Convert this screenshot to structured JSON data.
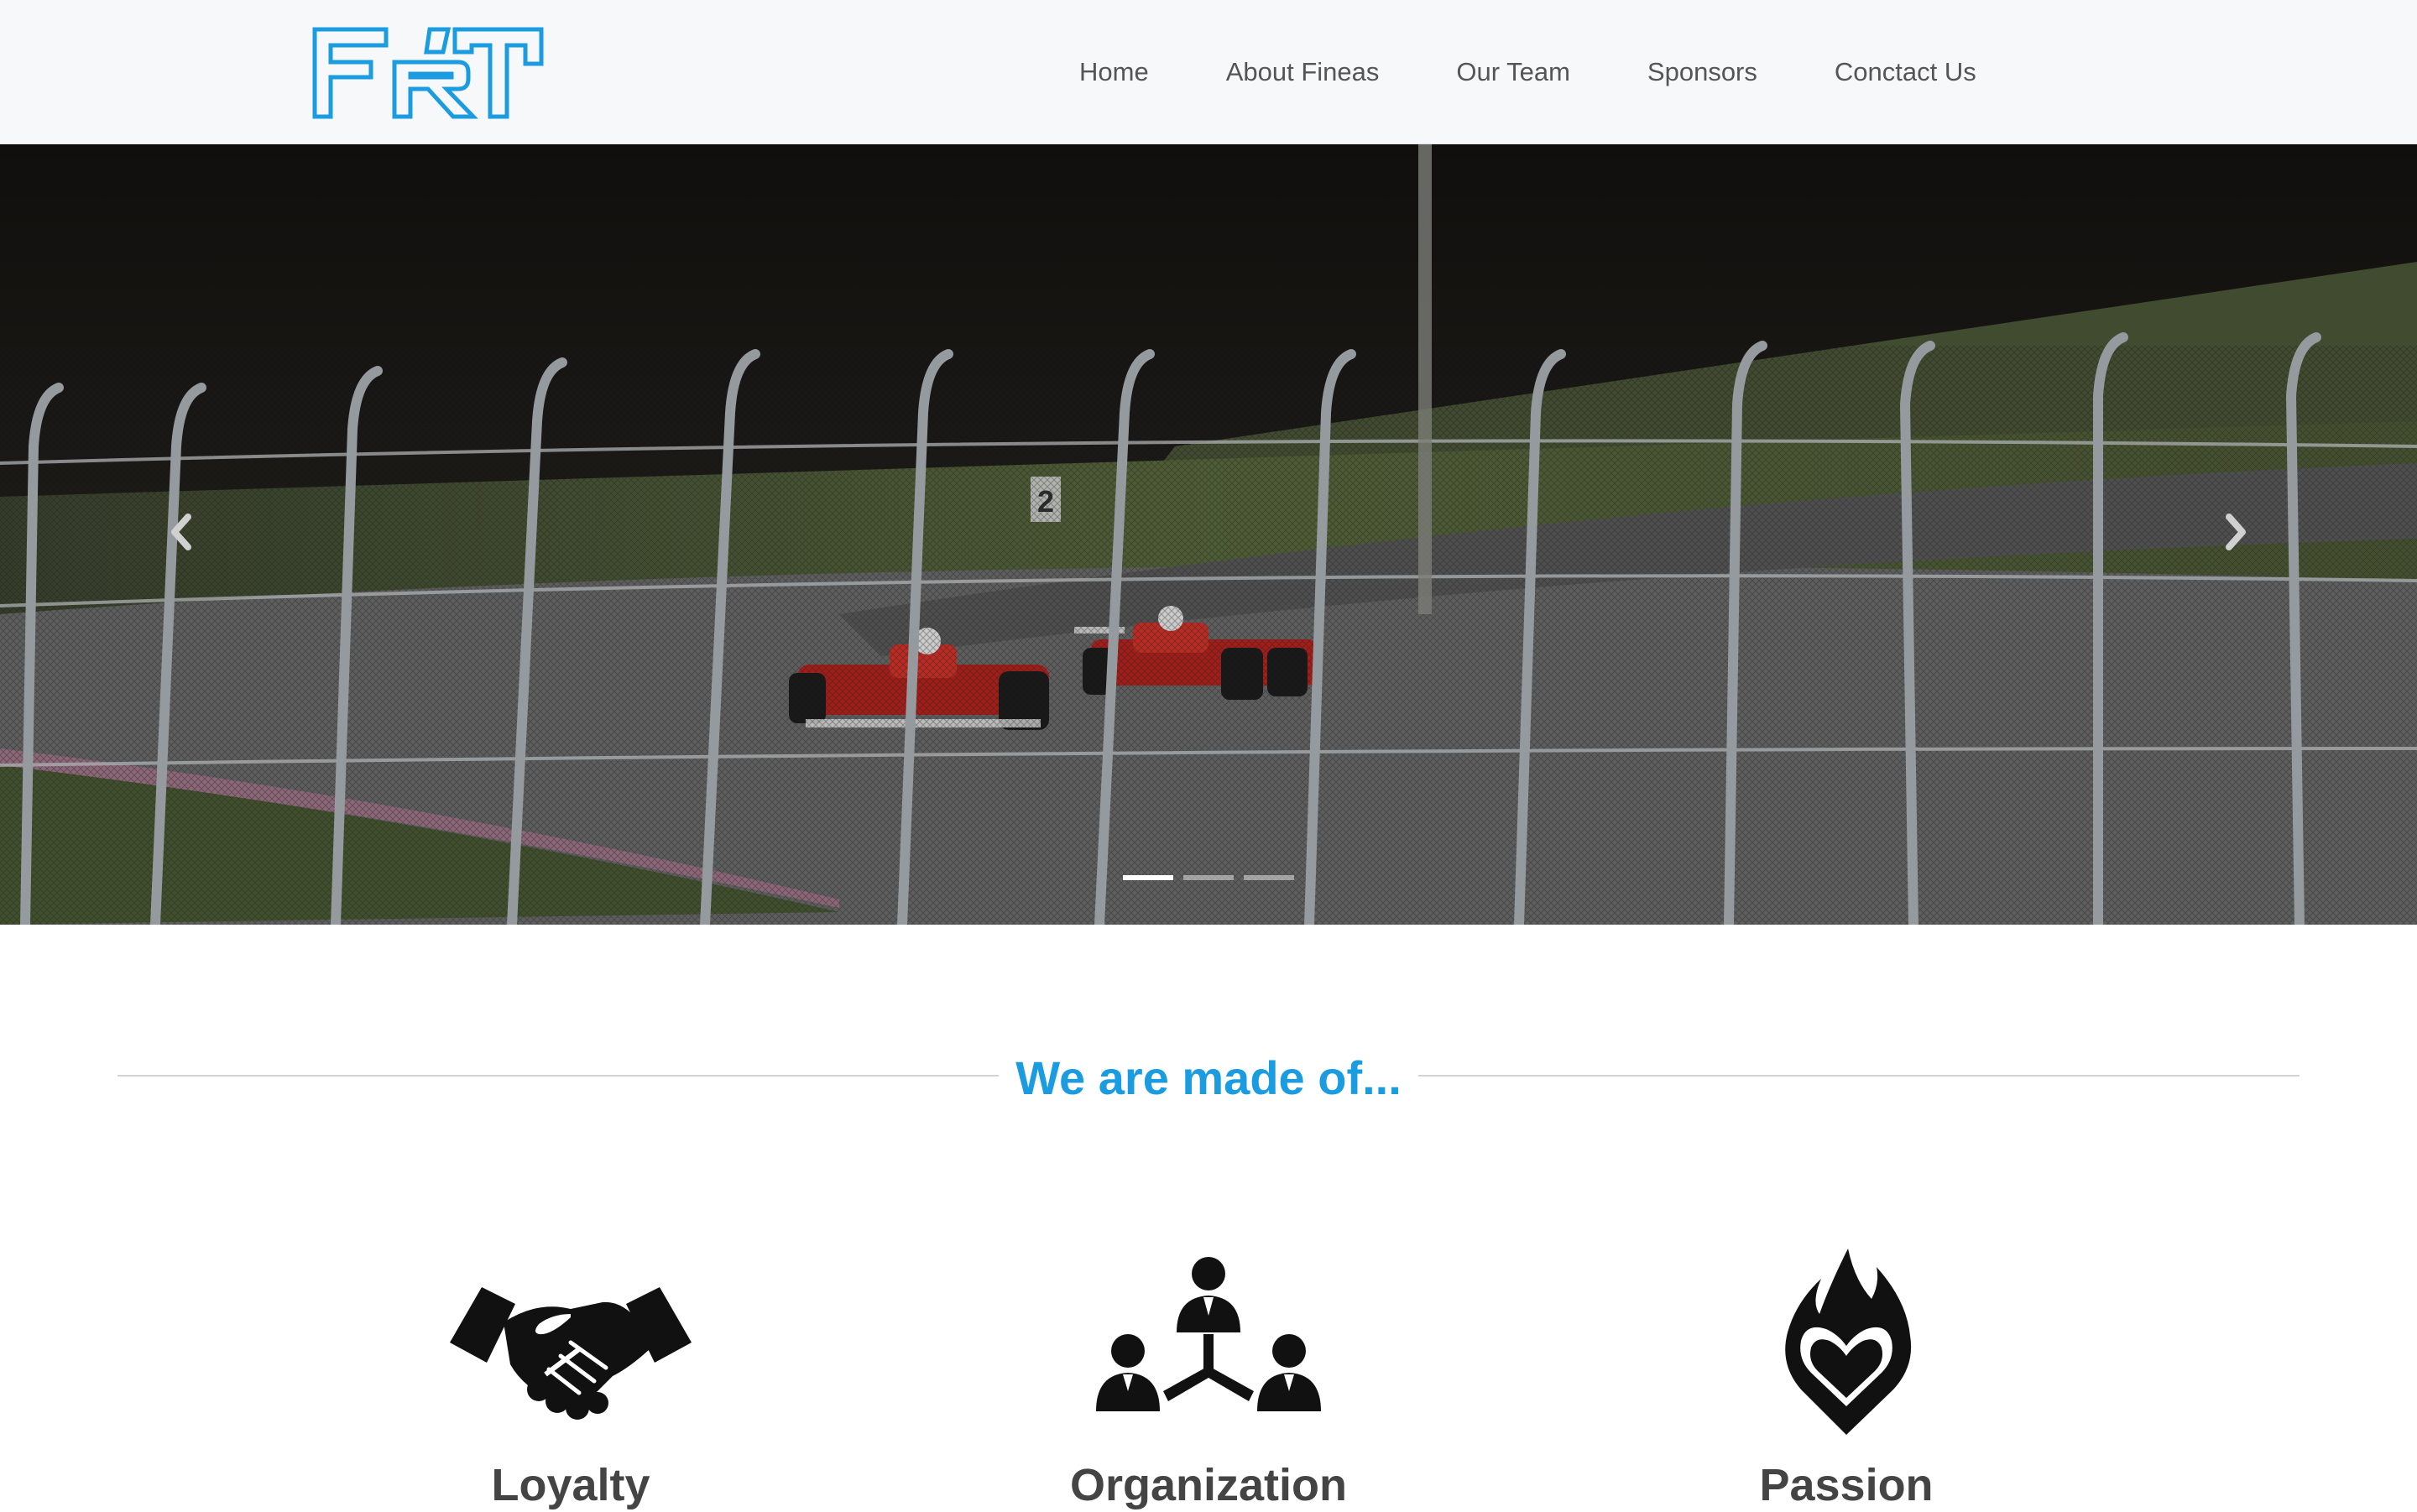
{
  "brand": {
    "logo_text": "FRT",
    "logo_color": "#1b9be0"
  },
  "nav": {
    "items": [
      {
        "label": "Home"
      },
      {
        "label": "About Fineas"
      },
      {
        "label": "Our Team"
      },
      {
        "label": "Sponsors"
      },
      {
        "label": "Conctact Us"
      }
    ]
  },
  "carousel": {
    "prev_icon": "chevron-left-icon",
    "next_icon": "chevron-right-icon",
    "slide_count": 3,
    "active_slide": 1,
    "sign_number": "2"
  },
  "values_section": {
    "heading": "We are made of...",
    "accent_color": "#1b9be0",
    "items": [
      {
        "title": "Loyalty",
        "icon": "handshake-icon"
      },
      {
        "title": "Organization",
        "icon": "team-structure-icon"
      },
      {
        "title": "Passion",
        "icon": "flaming-heart-icon"
      }
    ]
  }
}
